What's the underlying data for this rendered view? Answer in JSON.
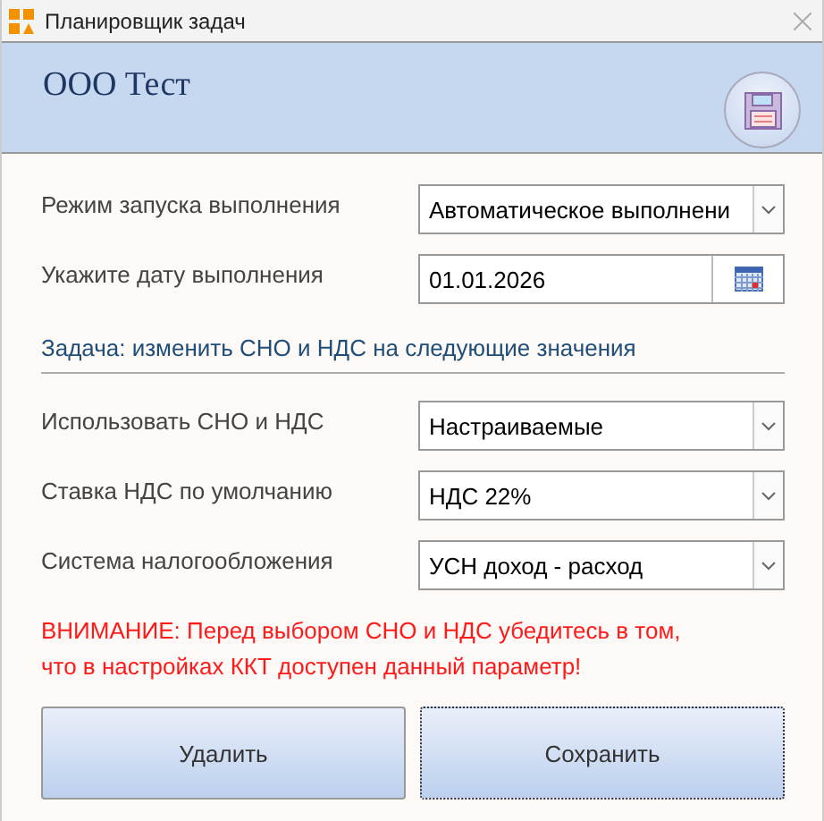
{
  "window": {
    "title": "Планировщик задач"
  },
  "header": {
    "title": "ООО Тест"
  },
  "schedule": [
    {
      "kind": "dropdown",
      "label": "Режим запуска выполнения",
      "value": "Автоматическое выполнени"
    },
    {
      "kind": "date",
      "label": "Укажите дату выполнения",
      "value": "01.01.2026"
    }
  ],
  "section_title": "Задача: изменить СНО и НДС на следующие значения",
  "settings": [
    {
      "kind": "dropdown",
      "label": "Использовать СНО и НДС",
      "value": "Настраиваемые"
    },
    {
      "kind": "dropdown",
      "label": "Ставка НДС по умолчанию",
      "value": "НДС 22%"
    },
    {
      "kind": "dropdown",
      "label": "Система налогообложения",
      "value": "УСН доход - расход"
    }
  ],
  "warning": "ВНИМАНИЕ: Перед выбором СНО и НДС убедитесь в том, что в настройках ККТ доступен данный параметр!",
  "buttons": [
    {
      "label": "Удалить",
      "focused": false
    },
    {
      "label": "Сохранить",
      "focused": true
    }
  ]
}
